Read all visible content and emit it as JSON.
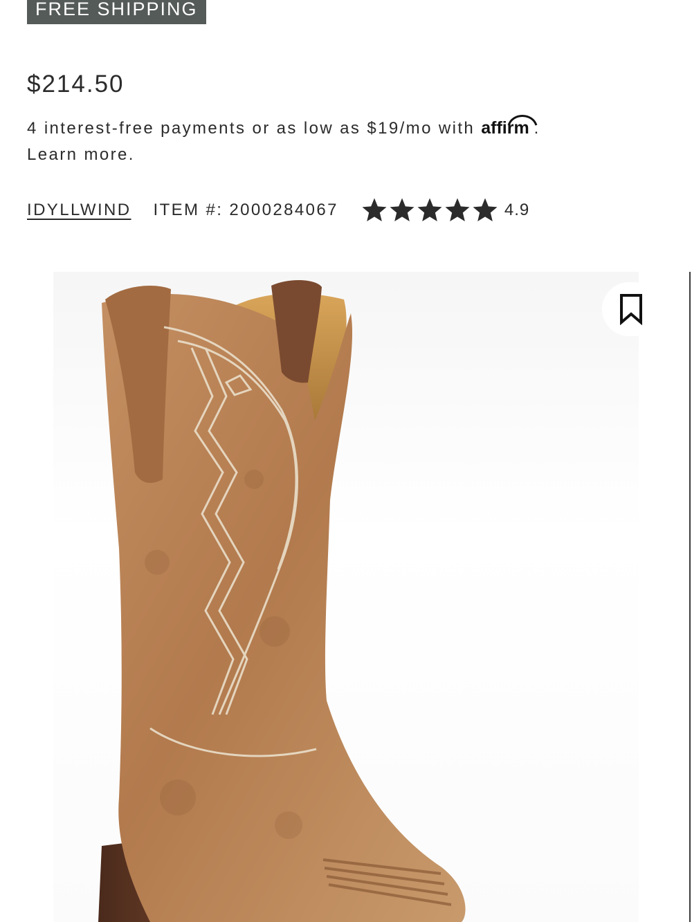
{
  "badge": {
    "label": "FREE SHIPPING"
  },
  "product": {
    "price": "$214.50",
    "payments_text": "4 interest-free payments or as low as $19/mo with",
    "affirm_logo": "affirm",
    "payments_end": ".",
    "learn_more": "Learn more.",
    "brand": "IDYLLWIND",
    "item_number": "ITEM #: 2000284067",
    "rating": 4.9,
    "rating_label": "4.9",
    "star_count": 5
  },
  "colors": {
    "badge_bg": "#555b58",
    "text": "#2b2b2b",
    "boot_leather": "#b9845a",
    "stitching": "#eadfcb"
  },
  "icons": {
    "star": "star-icon",
    "bookmark": "bookmark-icon"
  },
  "image": {
    "subject": "boot-image"
  }
}
